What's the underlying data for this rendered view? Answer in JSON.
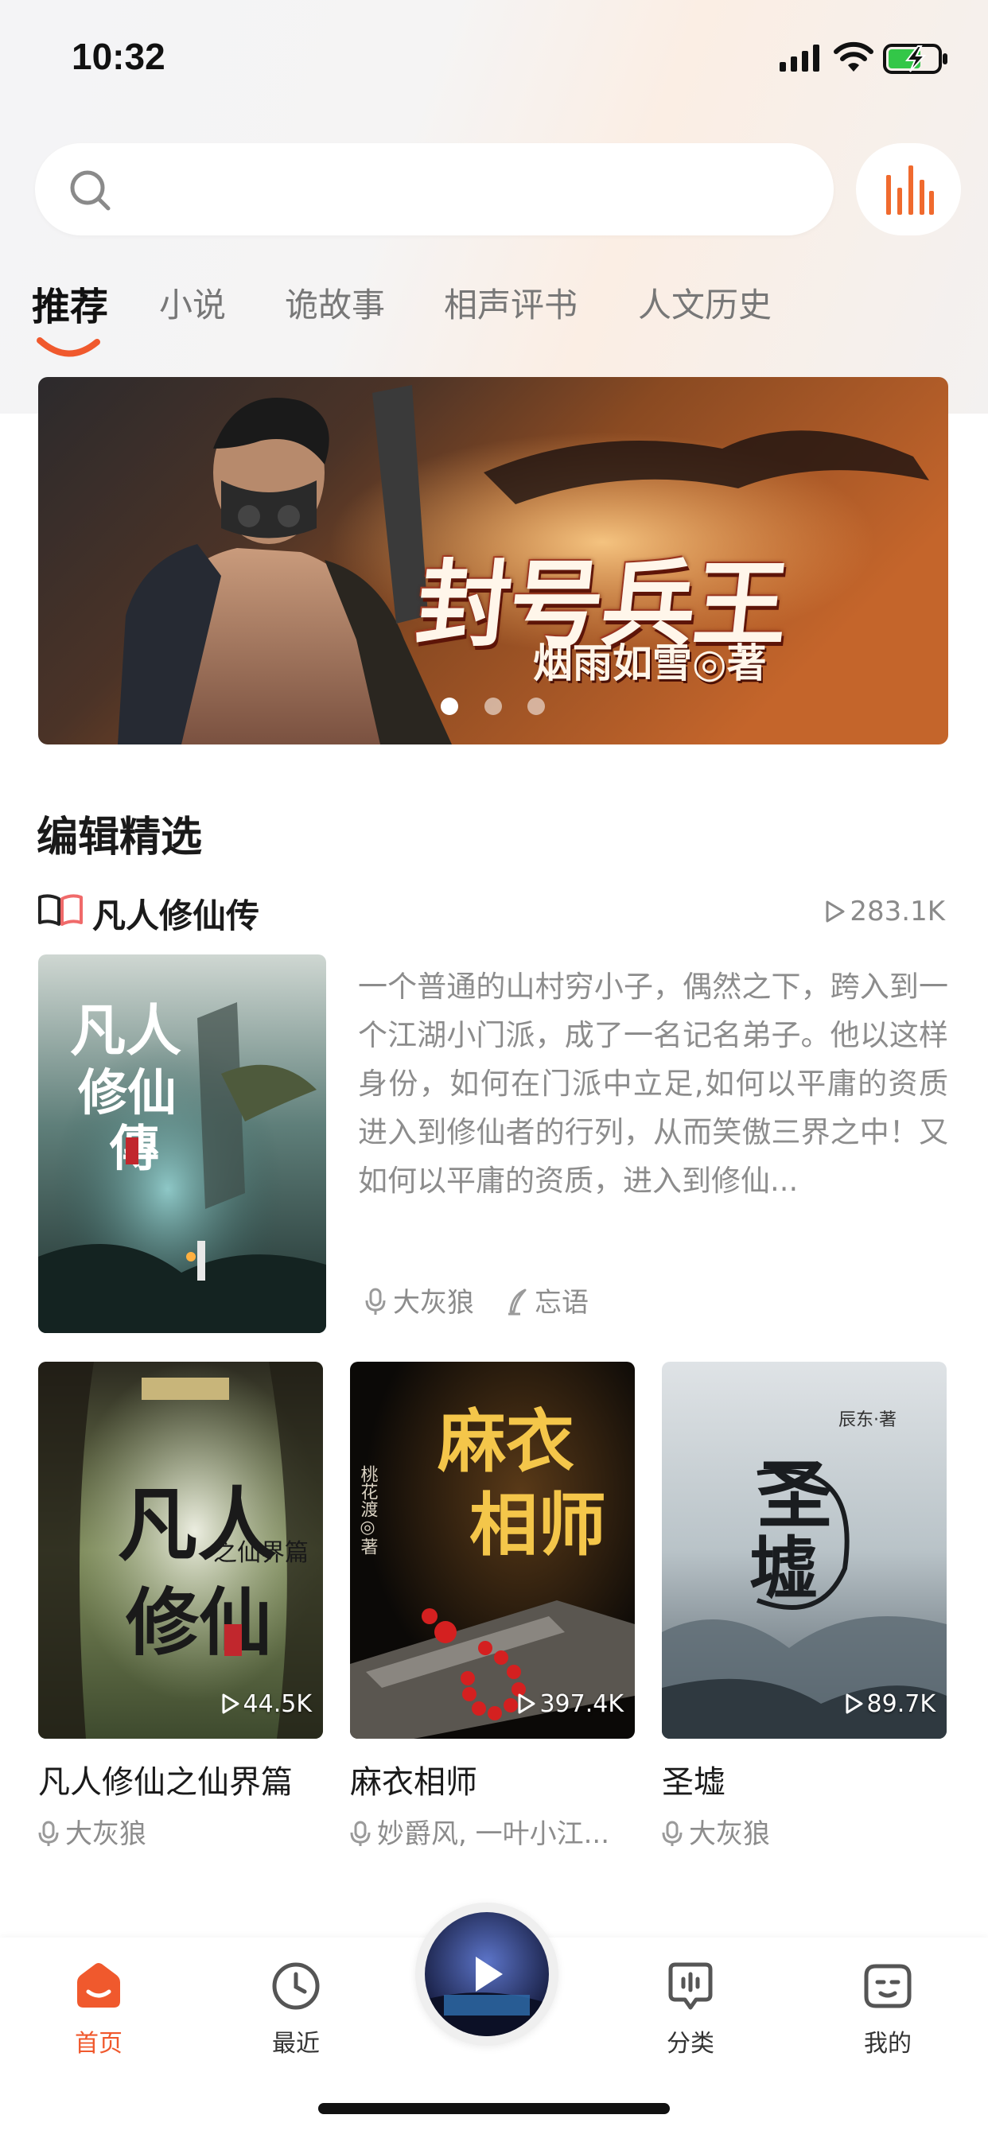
{
  "status_bar": {
    "time": "10:32"
  },
  "search": {
    "placeholder": ""
  },
  "tabs": [
    {
      "label": "推荐",
      "active": true
    },
    {
      "label": "小说",
      "active": false
    },
    {
      "label": "诡故事",
      "active": false
    },
    {
      "label": "相声评书",
      "active": false
    },
    {
      "label": "人文历史",
      "active": false
    }
  ],
  "banner": {
    "title": "封号兵王",
    "author": "烟雨如雪◎著",
    "dots": 3,
    "active_dot": 0
  },
  "editors_pick": {
    "section_title": "编辑精选",
    "featured": {
      "title": "凡人修仙传",
      "play_count": "283.1K",
      "description": "一个普通的山村穷小子，偶然之下，跨入到一个江湖小门派，成了一名记名弟子。他以这样身份，如何在门派中立足,如何以平庸的资质进入到修仙者的行列，从而笑傲三界之中！又如何以平庸的资质，进入到修仙...",
      "narrator": "大灰狼",
      "writer": "忘语"
    },
    "books": [
      {
        "title": "凡人修仙之仙界篇",
        "play_count": "44.5K",
        "narrator": "大灰狼"
      },
      {
        "title": "麻衣相师",
        "play_count": "397.4K",
        "narrator": "妙爵风, 一叶小江..."
      },
      {
        "title": "圣墟",
        "play_count": "89.7K",
        "narrator": "大灰狼"
      }
    ]
  },
  "tabbar": {
    "home": "首页",
    "recent": "最近",
    "category": "分类",
    "mine": "我的"
  },
  "colors": {
    "accent": "#f0592d",
    "text_primary": "#1a1a1a",
    "text_secondary": "#8c8c8c"
  },
  "icons": {
    "search": "search-icon",
    "audio": "audio-bars-icon",
    "book": "book-open-icon",
    "play": "play-triangle-icon",
    "mic": "microphone-icon",
    "pen": "pen-icon",
    "home": "home-icon",
    "recent": "clock-icon",
    "category": "category-chat-icon",
    "mine": "face-icon"
  }
}
